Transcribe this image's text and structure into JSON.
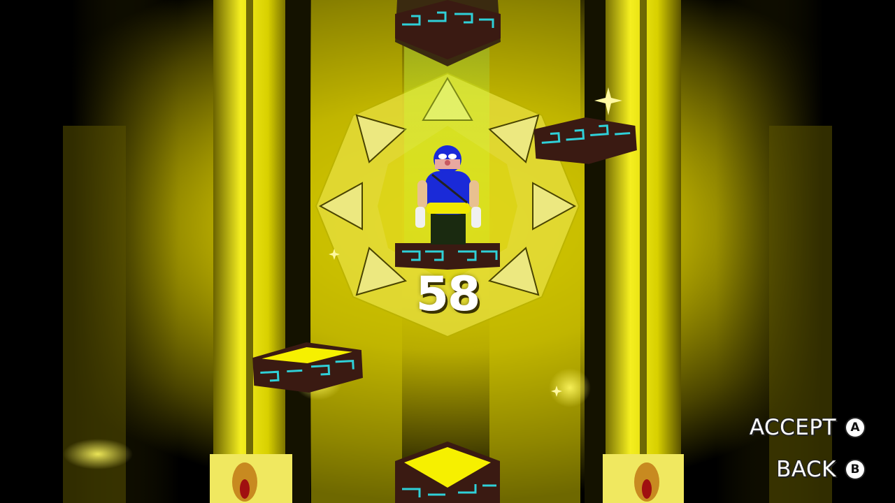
{
  "hud": {
    "level_number": "58",
    "accept": {
      "label": "ACCEPT",
      "button": "A"
    },
    "back": {
      "label": "BACK",
      "button": "B"
    }
  },
  "colors": {
    "background": "#000000",
    "glow_yellow": "#e8e000",
    "pillar_yellow": "#f2ec10",
    "platform_brown": "#3a1a12",
    "platform_pattern": "#2fd0d8",
    "character_suit": "#1a2ad8",
    "character_belt": "#f0e800"
  },
  "icons": {
    "accept_button": "a-button-icon",
    "back_button": "b-button-icon",
    "sparkle": "sparkle-icon"
  }
}
